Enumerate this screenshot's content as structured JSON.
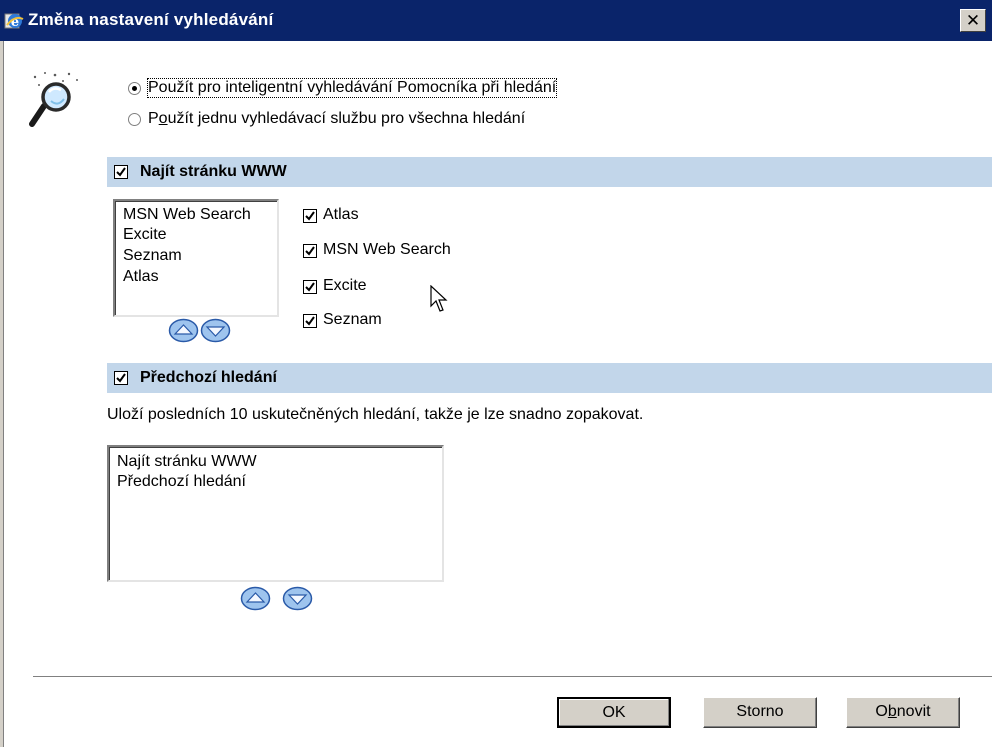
{
  "window": {
    "title": "Změna nastavení vyhledávání",
    "close_glyph": "✕",
    "title_color": "#0a246a"
  },
  "search_mode": {
    "option_smart": {
      "label": "Použít pro inteligentní vyhledávání Pomocníka při hledání",
      "selected": true
    },
    "option_single_pre": "P",
    "option_single_accel": "o",
    "option_single_post": "užít jednu vyhledávací službu pro všechna hledání",
    "option_single_selected": false
  },
  "find_web": {
    "header_label": "Najít stránku WWW",
    "checked": true,
    "order_list": [
      "MSN Web Search",
      "Excite",
      "Seznam",
      "Atlas"
    ],
    "providers": [
      {
        "label": "Atlas",
        "checked": true
      },
      {
        "label": "MSN Web Search",
        "checked": true
      },
      {
        "label": "Excite",
        "checked": true
      },
      {
        "label": "Seznam",
        "checked": true
      }
    ]
  },
  "previous_searches": {
    "header_label": "Předchozí hledání",
    "checked": true,
    "description": "Uloží posledních 10 uskutečněných hledání, takže je lze snadno zopakovat.",
    "order_list": [
      "Najít stránku WWW",
      "Předchozí hledání"
    ]
  },
  "buttons": {
    "ok": "OK",
    "cancel": "Storno",
    "restore_pre": "O",
    "restore_accel": "b",
    "restore_post": "novit"
  },
  "colors": {
    "section_header_bg": "#c2d6ea",
    "dialog_face": "#d4d0c8"
  },
  "icons": [
    "ie-icon",
    "magnifier-icon",
    "arrow-up-icon",
    "arrow-down-icon",
    "check-icon",
    "mouse-cursor-icon"
  ]
}
